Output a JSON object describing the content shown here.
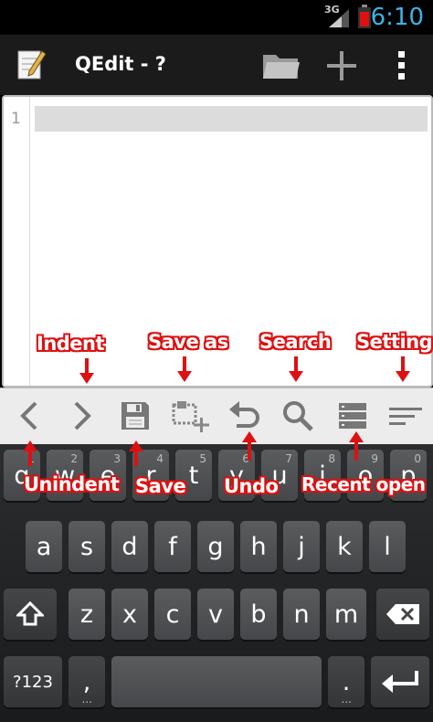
{
  "status_bar": {
    "network": "3G",
    "time": "6:10"
  },
  "action_bar": {
    "title": "QEdit - ?"
  },
  "editor": {
    "line_number": "1"
  },
  "toolbar": {
    "items": [
      "unindent",
      "indent",
      "save",
      "save-as",
      "undo",
      "search",
      "recent-open",
      "settings"
    ]
  },
  "annotations": {
    "indent": "Indent",
    "save_as": "Save as",
    "search": "Search",
    "setting": "Setting",
    "unindent": "Unindent",
    "save": "Save",
    "undo": "Undo",
    "recent_open": "Recent open"
  },
  "keyboard": {
    "row1": [
      {
        "label": "q",
        "hint": "1"
      },
      {
        "label": "w",
        "hint": "2"
      },
      {
        "label": "e",
        "hint": "3"
      },
      {
        "label": "r",
        "hint": "4"
      },
      {
        "label": "t",
        "hint": "5"
      },
      {
        "label": "y",
        "hint": "6"
      },
      {
        "label": "u",
        "hint": "7"
      },
      {
        "label": "i",
        "hint": "8"
      },
      {
        "label": "o",
        "hint": "9"
      },
      {
        "label": "p",
        "hint": "0"
      }
    ],
    "row2": [
      "a",
      "s",
      "d",
      "f",
      "g",
      "h",
      "j",
      "k",
      "l"
    ],
    "row3": [
      "z",
      "x",
      "c",
      "v",
      "b",
      "n",
      "m"
    ],
    "symbols_key": "?123",
    "comma_key": ",",
    "period_key": ".",
    "period_hint": "...",
    "comma_hint": "..."
  },
  "colors": {
    "annotation_red": "#dd1111",
    "clock_blue": "#39b5e6"
  }
}
